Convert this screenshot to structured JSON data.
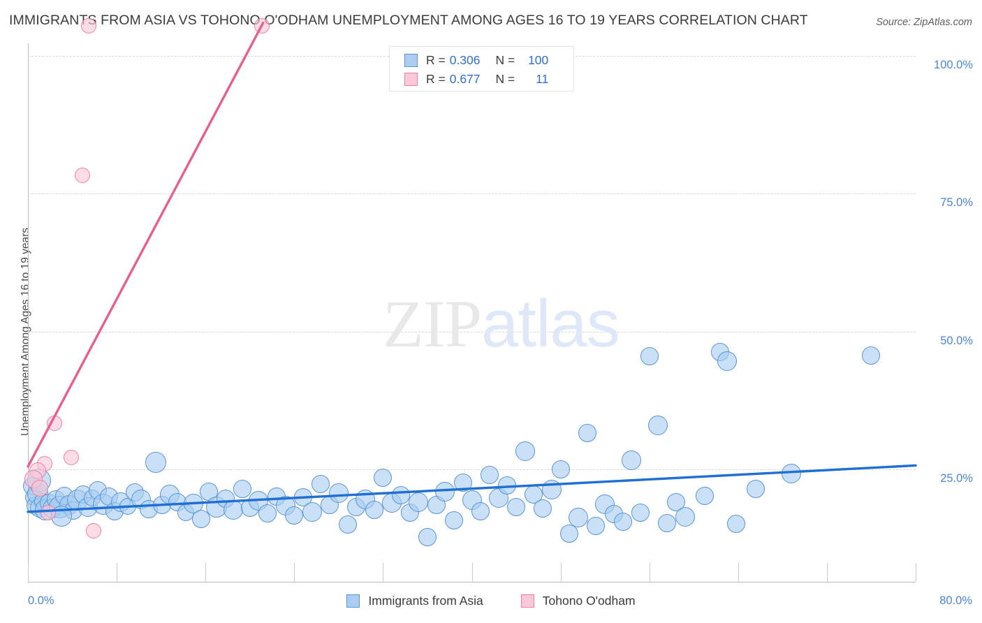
{
  "header": {
    "title": "IMMIGRANTS FROM ASIA VS TOHONO O'ODHAM UNEMPLOYMENT AMONG AGES 16 TO 19 YEARS CORRELATION CHART",
    "source": "Source: ZipAtlas.com"
  },
  "watermark": {
    "part1": "ZIP",
    "part2": "atlas"
  },
  "stats": {
    "rows": [
      {
        "series": "Immigrants from Asia",
        "color": "#aacdf0",
        "r_label": "R =",
        "r_value": "0.306",
        "n_label": "N =",
        "n_value": "100"
      },
      {
        "series": "Tohono O'odham",
        "color": "#fac8d7",
        "r_label": "R =",
        "r_value": "0.677",
        "n_label": "N =",
        "n_value": "11"
      }
    ]
  },
  "legend": {
    "items": [
      {
        "label": "Immigrants from Asia",
        "color": "#aacdf0"
      },
      {
        "label": "Tohono O'odham",
        "color": "#fac8d7"
      }
    ]
  },
  "chart_data": {
    "type": "scatter",
    "title": "IMMIGRANTS FROM ASIA VS TOHONO O'ODHAM UNEMPLOYMENT AMONG AGES 16 TO 19 YEARS CORRELATION CHART",
    "xlabel": "",
    "ylabel": "Unemployment Among Ages 16 to 19 years",
    "xlim": [
      0,
      80
    ],
    "ylim": [
      0,
      106
    ],
    "grid": true,
    "legend_position": "bottom",
    "x_ticks": [
      0,
      8,
      16,
      24,
      32,
      40,
      48,
      56,
      64,
      72,
      80
    ],
    "x_tick_labels": {
      "first": "0.0%",
      "last": "80.0%"
    },
    "y_ticks": [
      25,
      50,
      75,
      100
    ],
    "y_tick_labels": [
      "25.0%",
      "50.0%",
      "75.0%",
      "100.0%"
    ],
    "series": [
      {
        "name": "Immigrants from Asia",
        "color": "#aacdf0",
        "edge_color": "#5b95d6",
        "r": 0.306,
        "n": 100,
        "trendline": {
          "x0": 0.0,
          "y0": 17.3,
          "x1": 80.0,
          "y1": 25.7
        },
        "points": [
          {
            "x": 0.4,
            "y": 21.9,
            "s": 26
          },
          {
            "x": 0.5,
            "y": 19.9,
            "s": 24
          },
          {
            "x": 0.7,
            "y": 18.4,
            "s": 26
          },
          {
            "x": 0.9,
            "y": 20.6,
            "s": 30
          },
          {
            "x": 1.1,
            "y": 18.0,
            "s": 28
          },
          {
            "x": 1.3,
            "y": 19.2,
            "s": 24
          },
          {
            "x": 1.6,
            "y": 17.6,
            "s": 30
          },
          {
            "x": 1.9,
            "y": 18.9,
            "s": 26
          },
          {
            "x": 2.2,
            "y": 17.9,
            "s": 28
          },
          {
            "x": 2.5,
            "y": 19.6,
            "s": 26
          },
          {
            "x": 2.9,
            "y": 18.2,
            "s": 32
          },
          {
            "x": 3.3,
            "y": 20.2,
            "s": 26
          },
          {
            "x": 3.7,
            "y": 18.6,
            "s": 28
          },
          {
            "x": 4.1,
            "y": 17.5,
            "s": 26
          },
          {
            "x": 4.5,
            "y": 19.4,
            "s": 30
          },
          {
            "x": 5.0,
            "y": 20.5,
            "s": 26
          },
          {
            "x": 5.4,
            "y": 18.1,
            "s": 28
          },
          {
            "x": 5.8,
            "y": 19.8,
            "s": 24
          },
          {
            "x": 6.3,
            "y": 21.2,
            "s": 26
          },
          {
            "x": 6.8,
            "y": 18.7,
            "s": 30
          },
          {
            "x": 7.3,
            "y": 20.0,
            "s": 26
          },
          {
            "x": 7.8,
            "y": 17.4,
            "s": 26
          },
          {
            "x": 8.4,
            "y": 19.1,
            "s": 28
          },
          {
            "x": 9.0,
            "y": 18.3,
            "s": 24
          },
          {
            "x": 9.6,
            "y": 20.8,
            "s": 26
          },
          {
            "x": 10.2,
            "y": 19.5,
            "s": 28
          },
          {
            "x": 10.9,
            "y": 17.8,
            "s": 26
          },
          {
            "x": 11.5,
            "y": 26.3,
            "s": 30
          },
          {
            "x": 12.1,
            "y": 18.5,
            "s": 26
          },
          {
            "x": 12.8,
            "y": 20.4,
            "s": 28
          },
          {
            "x": 13.5,
            "y": 19.0,
            "s": 26
          },
          {
            "x": 14.2,
            "y": 17.2,
            "s": 24
          },
          {
            "x": 14.9,
            "y": 18.8,
            "s": 28
          },
          {
            "x": 15.6,
            "y": 16.0,
            "s": 26
          },
          {
            "x": 16.3,
            "y": 20.9,
            "s": 26
          },
          {
            "x": 17.0,
            "y": 18.2,
            "s": 30
          },
          {
            "x": 17.8,
            "y": 19.7,
            "s": 26
          },
          {
            "x": 18.5,
            "y": 17.6,
            "s": 28
          },
          {
            "x": 19.3,
            "y": 21.4,
            "s": 26
          },
          {
            "x": 20.0,
            "y": 18.0,
            "s": 26
          },
          {
            "x": 20.8,
            "y": 19.3,
            "s": 28
          },
          {
            "x": 21.6,
            "y": 17.0,
            "s": 26
          },
          {
            "x": 22.4,
            "y": 20.1,
            "s": 26
          },
          {
            "x": 23.2,
            "y": 18.4,
            "s": 28
          },
          {
            "x": 24.0,
            "y": 16.6,
            "s": 26
          },
          {
            "x": 24.8,
            "y": 19.9,
            "s": 26
          },
          {
            "x": 25.6,
            "y": 17.3,
            "s": 28
          },
          {
            "x": 26.4,
            "y": 22.3,
            "s": 26
          },
          {
            "x": 27.2,
            "y": 18.6,
            "s": 26
          },
          {
            "x": 28.0,
            "y": 20.7,
            "s": 28
          },
          {
            "x": 28.8,
            "y": 15.0,
            "s": 26
          },
          {
            "x": 29.6,
            "y": 18.1,
            "s": 26
          },
          {
            "x": 30.4,
            "y": 19.6,
            "s": 28
          },
          {
            "x": 31.2,
            "y": 17.7,
            "s": 26
          },
          {
            "x": 32.0,
            "y": 23.5,
            "s": 26
          },
          {
            "x": 32.8,
            "y": 18.9,
            "s": 28
          },
          {
            "x": 33.6,
            "y": 20.3,
            "s": 26
          },
          {
            "x": 34.4,
            "y": 17.1,
            "s": 26
          },
          {
            "x": 35.2,
            "y": 19.0,
            "s": 28
          },
          {
            "x": 36.0,
            "y": 12.7,
            "s": 26
          },
          {
            "x": 36.8,
            "y": 18.5,
            "s": 26
          },
          {
            "x": 37.6,
            "y": 21.0,
            "s": 28
          },
          {
            "x": 38.4,
            "y": 15.8,
            "s": 26
          },
          {
            "x": 39.2,
            "y": 22.6,
            "s": 26
          },
          {
            "x": 40.0,
            "y": 19.4,
            "s": 28
          },
          {
            "x": 40.8,
            "y": 17.4,
            "s": 26
          },
          {
            "x": 41.6,
            "y": 24.0,
            "s": 26
          },
          {
            "x": 42.4,
            "y": 19.8,
            "s": 28
          },
          {
            "x": 43.2,
            "y": 22.1,
            "s": 26
          },
          {
            "x": 44.0,
            "y": 18.2,
            "s": 26
          },
          {
            "x": 44.8,
            "y": 28.3,
            "s": 28
          },
          {
            "x": 45.6,
            "y": 20.5,
            "s": 26
          },
          {
            "x": 46.4,
            "y": 17.9,
            "s": 26
          },
          {
            "x": 47.2,
            "y": 21.3,
            "s": 28
          },
          {
            "x": 48.0,
            "y": 25.0,
            "s": 26
          },
          {
            "x": 48.8,
            "y": 13.4,
            "s": 26
          },
          {
            "x": 49.6,
            "y": 16.2,
            "s": 28
          },
          {
            "x": 50.4,
            "y": 31.6,
            "s": 26
          },
          {
            "x": 51.2,
            "y": 14.8,
            "s": 26
          },
          {
            "x": 52.0,
            "y": 18.7,
            "s": 28
          },
          {
            "x": 52.8,
            "y": 16.9,
            "s": 26
          },
          {
            "x": 53.6,
            "y": 15.5,
            "s": 26
          },
          {
            "x": 54.4,
            "y": 26.6,
            "s": 28
          },
          {
            "x": 55.2,
            "y": 17.2,
            "s": 26
          },
          {
            "x": 56.0,
            "y": 45.5,
            "s": 26
          },
          {
            "x": 56.8,
            "y": 33.0,
            "s": 28
          },
          {
            "x": 57.6,
            "y": 15.2,
            "s": 26
          },
          {
            "x": 58.4,
            "y": 19.1,
            "s": 26
          },
          {
            "x": 59.2,
            "y": 16.4,
            "s": 28
          },
          {
            "x": 61.0,
            "y": 20.2,
            "s": 26
          },
          {
            "x": 62.4,
            "y": 46.3,
            "s": 26
          },
          {
            "x": 63.0,
            "y": 44.7,
            "s": 28
          },
          {
            "x": 63.8,
            "y": 15.1,
            "s": 26
          },
          {
            "x": 65.6,
            "y": 21.4,
            "s": 26
          },
          {
            "x": 68.8,
            "y": 24.2,
            "s": 28
          },
          {
            "x": 76.0,
            "y": 45.6,
            "s": 26
          },
          {
            "x": 3.0,
            "y": 16.5,
            "s": 30
          },
          {
            "x": 1.0,
            "y": 23.0,
            "s": 34
          }
        ]
      },
      {
        "name": "Tohono O'odham",
        "color": "#fac8d7",
        "edge_color": "#ec7fa4",
        "r": 0.677,
        "n": 11,
        "trendline": {
          "x0": 0.0,
          "y0": 25.5,
          "x1": 21.2,
          "y1": 106.0
        },
        "points": [
          {
            "x": 5.5,
            "y": 105.5,
            "s": 22
          },
          {
            "x": 21.1,
            "y": 105.5,
            "s": 22
          },
          {
            "x": 4.9,
            "y": 78.3,
            "s": 22
          },
          {
            "x": 2.4,
            "y": 33.4,
            "s": 22
          },
          {
            "x": 3.9,
            "y": 27.2,
            "s": 22
          },
          {
            "x": 1.5,
            "y": 26.0,
            "s": 22
          },
          {
            "x": 0.9,
            "y": 24.8,
            "s": 24
          },
          {
            "x": 0.5,
            "y": 23.2,
            "s": 26
          },
          {
            "x": 1.1,
            "y": 21.6,
            "s": 24
          },
          {
            "x": 1.8,
            "y": 17.2,
            "s": 22
          },
          {
            "x": 5.9,
            "y": 13.8,
            "s": 22
          }
        ]
      }
    ]
  },
  "axes": {
    "y_labels": [
      "100.0%",
      "75.0%",
      "50.0%",
      "25.0%"
    ],
    "x_first": "0.0%",
    "x_last": "80.0%",
    "y_title": "Unemployment Among Ages 16 to 19 years"
  }
}
